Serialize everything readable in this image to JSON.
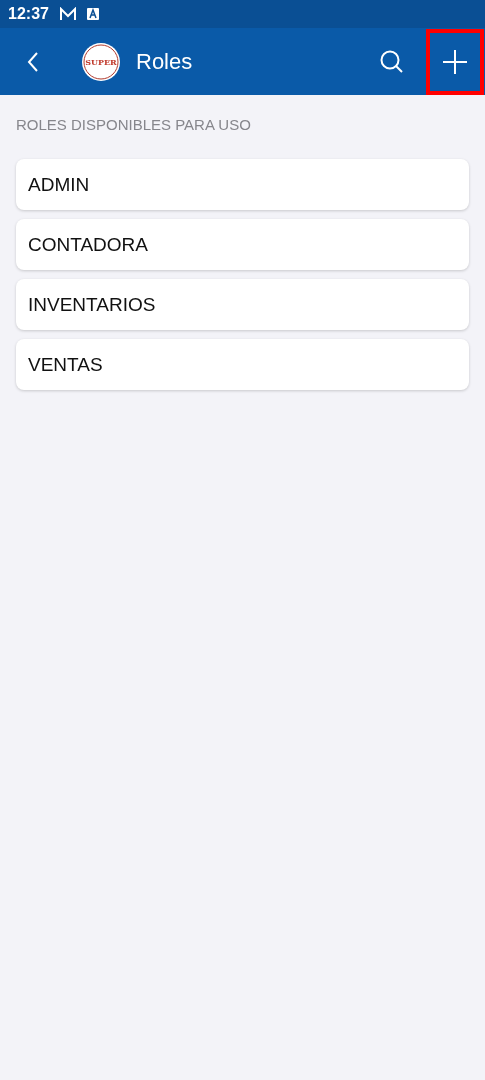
{
  "status_bar": {
    "time": "12:37"
  },
  "app_bar": {
    "title": "Roles",
    "logo_text": "SUPER",
    "add_button": {
      "highlighted": true
    }
  },
  "section_header": "ROLES DISPONIBLES PARA USO",
  "roles": [
    {
      "name": "ADMIN"
    },
    {
      "name": "CONTADORA"
    },
    {
      "name": "INVENTARIOS"
    },
    {
      "name": "VENTAS"
    }
  ]
}
